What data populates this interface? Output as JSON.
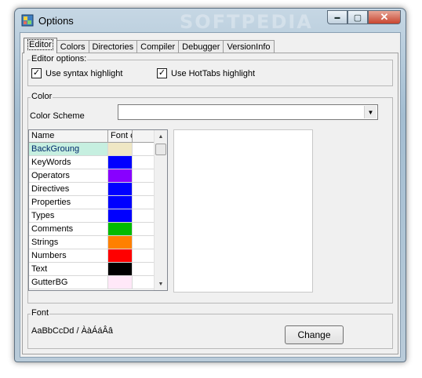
{
  "window": {
    "title": "Options",
    "watermark": "SOFTPEDIA",
    "controls": {
      "minimize": "▬",
      "maximize": "▢",
      "close": "✕"
    }
  },
  "tabs": [
    {
      "label": "Editor",
      "active": true
    },
    {
      "label": "Colors"
    },
    {
      "label": "Directories"
    },
    {
      "label": "Compiler"
    },
    {
      "label": "Debugger"
    },
    {
      "label": "VersionInfo"
    }
  ],
  "editor_options": {
    "label": "Editor options:",
    "syntax_highlight": {
      "label": "Use syntax highlight",
      "checked": true,
      "mark": "✓"
    },
    "hottabs_highlight": {
      "label": "Use HotTabs highlight",
      "checked": true,
      "mark": "✓"
    }
  },
  "color": {
    "group_label": "Color",
    "scheme_label": "Color Scheme",
    "scheme_value": "",
    "scheme_arrow": "▼",
    "grid_headers": {
      "name": "Name",
      "font": "Font c"
    },
    "scroll_up": "▲",
    "scroll_down": "▼",
    "items": [
      {
        "name": "BackGroung",
        "color": "#efe7c4",
        "selected": true
      },
      {
        "name": "KeyWords",
        "color": "#0000ff"
      },
      {
        "name": "Operators",
        "color": "#8800ff"
      },
      {
        "name": "Directives",
        "color": "#0000ff"
      },
      {
        "name": "Properties",
        "color": "#0000ff"
      },
      {
        "name": "Types",
        "color": "#0000ff"
      },
      {
        "name": "Comments",
        "color": "#00bb00"
      },
      {
        "name": "Strings",
        "color": "#ff8000"
      },
      {
        "name": "Numbers",
        "color": "#ff0000"
      },
      {
        "name": "Text",
        "color": "#000000"
      },
      {
        "name": "GutterBG",
        "color": "#ffe8f8"
      }
    ]
  },
  "font": {
    "group_label": "Font",
    "sample": "AaBbCcDd / ÀàÁáÂâ",
    "change_button": "Change"
  }
}
